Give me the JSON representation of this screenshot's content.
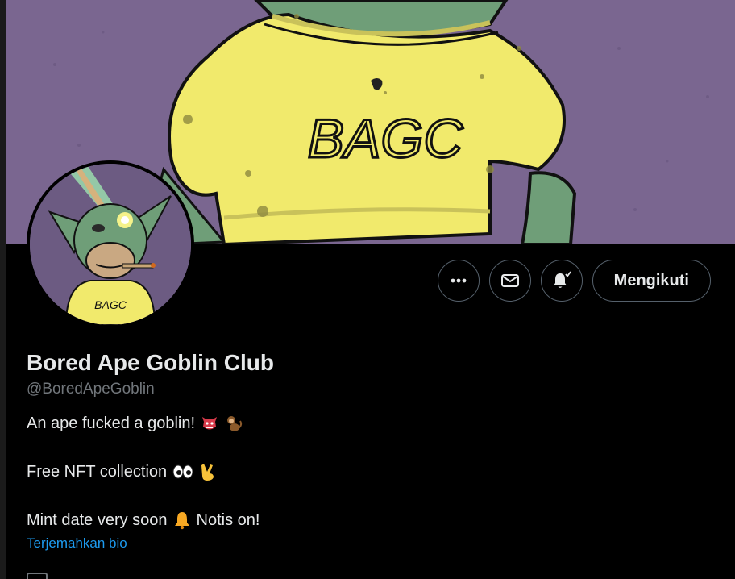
{
  "profile": {
    "display_name": "Bored Ape Goblin Club",
    "handle": "@BoredApeGoblin",
    "bio_line1": "An ape fucked a goblin!",
    "bio_line2": "Free NFT collection",
    "bio_line3_a": "Mint date very soon",
    "bio_line3_b": "Notis on!",
    "translate_label": "Terjemahkan bio"
  },
  "banner": {
    "shirt_text": "BAGC"
  },
  "avatar": {
    "shirt_text": "BAGC"
  },
  "actions": {
    "more_icon": "more-icon",
    "message_icon": "envelope-icon",
    "notify_icon": "bell-check-icon",
    "follow_label": "Mengikuti"
  },
  "colors": {
    "background": "#000000",
    "text_primary": "#e7e9ea",
    "text_secondary": "#71767b",
    "link": "#1d9bf0",
    "banner_purple": "#7a6690",
    "shirt_yellow": "#f1ea6c",
    "goblin_green": "#6f9e78"
  }
}
